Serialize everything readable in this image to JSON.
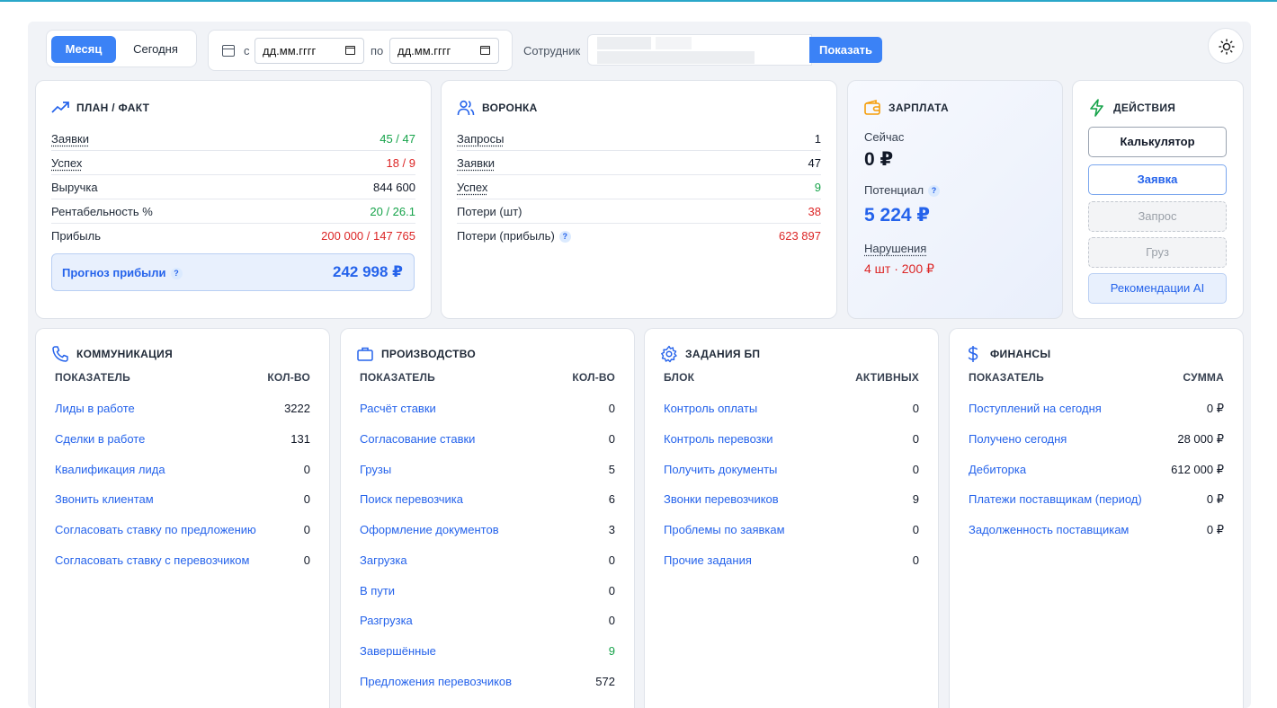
{
  "toolbar": {
    "period_month": "Месяц",
    "period_today": "Сегодня",
    "from_label": "с",
    "to_label": "по",
    "date_from_placeholder": "дд.мм.гггг",
    "date_to_placeholder": "дд.мм.гггг",
    "employee_label": "Сотрудник",
    "show_button": "Показать"
  },
  "plan_fact": {
    "title": "ПЛАН / ФАКТ",
    "rows": [
      {
        "label": "Заявки",
        "value": "45 / 47"
      },
      {
        "label": "Успех",
        "value": "18 / 9"
      },
      {
        "label": "Выручка",
        "value": "844 600"
      },
      {
        "label": "Рентабельность %",
        "value": "20 / 26.1"
      },
      {
        "label": "Прибыль",
        "value": "200 000 / 147 765"
      }
    ],
    "forecast_label": "Прогноз прибыли",
    "forecast_value": "242 998 ₽"
  },
  "funnel": {
    "title": "ВОРОНКА",
    "rows": [
      {
        "label": "Запросы",
        "value": "1"
      },
      {
        "label": "Заявки",
        "value": "47"
      },
      {
        "label": "Успех",
        "value": "9"
      },
      {
        "label": "Потери (шт)",
        "value": "38"
      },
      {
        "label": "Потери (прибыль)",
        "value": "623 897"
      }
    ]
  },
  "salary": {
    "title": "ЗАРПЛАТА",
    "now_label": "Сейчас",
    "now_value": "0 ₽",
    "potential_label": "Потенциал",
    "potential_value": "5 224 ₽",
    "violations_label": "Нарушения",
    "violations_value": "4 шт · 200 ₽"
  },
  "actions": {
    "title": "ДЕЙСТВИЯ",
    "buttons": [
      "Калькулятор",
      "Заявка",
      "Запрос",
      "Груз",
      "Рекомендации AI"
    ]
  },
  "communication": {
    "title": "КОММУНИКАЦИЯ",
    "col1": "ПОКАЗАТЕЛЬ",
    "col2": "КОЛ-ВО",
    "rows": [
      {
        "label": "Лиды в работе",
        "value": "3222"
      },
      {
        "label": "Сделки в работе",
        "value": "131"
      },
      {
        "label": "Квалификация лида",
        "value": "0"
      },
      {
        "label": "Звонить клиентам",
        "value": "0"
      },
      {
        "label": "Согласовать ставку по предложению",
        "value": "0"
      },
      {
        "label": "Согласовать ставку с перевозчиком",
        "value": "0"
      }
    ]
  },
  "production": {
    "title": "ПРОИЗВОДСТВО",
    "col1": "ПОКАЗАТЕЛЬ",
    "col2": "КОЛ-ВО",
    "rows": [
      {
        "label": "Расчёт ставки",
        "value": "0"
      },
      {
        "label": "Согласование ставки",
        "value": "0"
      },
      {
        "label": "Грузы",
        "value": "5"
      },
      {
        "label": "Поиск перевозчика",
        "value": "6"
      },
      {
        "label": "Оформление документов",
        "value": "3"
      },
      {
        "label": "Загрузка",
        "value": "0"
      },
      {
        "label": "В пути",
        "value": "0"
      },
      {
        "label": "Разгрузка",
        "value": "0"
      },
      {
        "label": "Завершённые",
        "value": "9"
      },
      {
        "label": "Предложения перевозчиков",
        "value": "572"
      }
    ]
  },
  "bp_tasks": {
    "title": "ЗАДАНИЯ БП",
    "col1": "БЛОК",
    "col2": "АКТИВНЫХ",
    "rows": [
      {
        "label": "Контроль оплаты",
        "value": "0"
      },
      {
        "label": "Контроль перевозки",
        "value": "0"
      },
      {
        "label": "Получить документы",
        "value": "0"
      },
      {
        "label": "Звонки перевозчиков",
        "value": "9"
      },
      {
        "label": "Проблемы по заявкам",
        "value": "0"
      },
      {
        "label": "Прочие задания",
        "value": "0"
      }
    ]
  },
  "finance": {
    "title": "ФИНАНСЫ",
    "col1": "ПОКАЗАТЕЛЬ",
    "col2": "СУММА",
    "rows": [
      {
        "label": "Поступлений на сегодня",
        "value": "0 ₽"
      },
      {
        "label": "Получено сегодня",
        "value": "28 000 ₽"
      },
      {
        "label": "Дебиторка",
        "value": "612 000 ₽"
      },
      {
        "label": "Платежи поставщикам (период)",
        "value": "0 ₽"
      },
      {
        "label": "Задолженность поставщикам",
        "value": "0 ₽"
      }
    ]
  },
  "colors": {
    "accent": "#3b82f6",
    "link": "#2563eb",
    "positive": "#16a34a",
    "negative": "#dc2626"
  }
}
